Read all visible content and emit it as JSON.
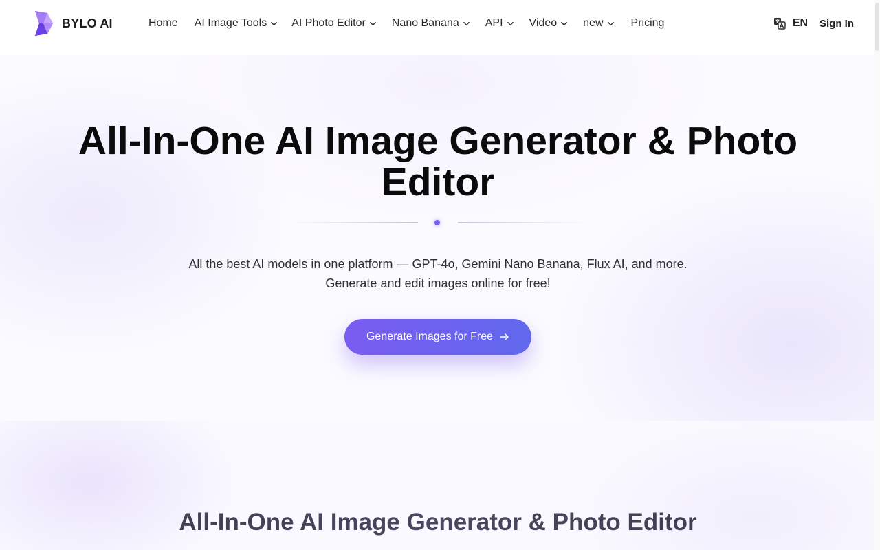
{
  "brand": {
    "name": "BYLO AI"
  },
  "nav": {
    "items": [
      {
        "label": "Home",
        "has_dropdown": false
      },
      {
        "label": "AI Image Tools",
        "has_dropdown": true
      },
      {
        "label": "AI Photo Editor",
        "has_dropdown": true
      },
      {
        "label": "Nano Banana",
        "has_dropdown": true
      },
      {
        "label": "API",
        "has_dropdown": true
      },
      {
        "label": "Video",
        "has_dropdown": true
      },
      {
        "label": "new",
        "has_dropdown": true
      },
      {
        "label": "Pricing",
        "has_dropdown": false
      }
    ]
  },
  "header_actions": {
    "language_icon": "translate-icon",
    "language": "EN",
    "sign_in": "Sign In"
  },
  "hero": {
    "title": "All-In-One AI Image Generator & Photo Editor",
    "subtitle_line1": "All the best AI models in one platform — GPT-4o, Gemini Nano Banana, Flux AI, and more.",
    "subtitle_line2": "Generate and edit images online for free!",
    "cta_label": "Generate Images for Free",
    "cta_icon": "arrow-right-icon"
  },
  "section2": {
    "title": "All-In-One AI Image Generator & Photo Editor"
  },
  "colors": {
    "accent": "#7B5CF0",
    "accent_end": "#6169EE",
    "text_dark": "#0B0B0B"
  }
}
